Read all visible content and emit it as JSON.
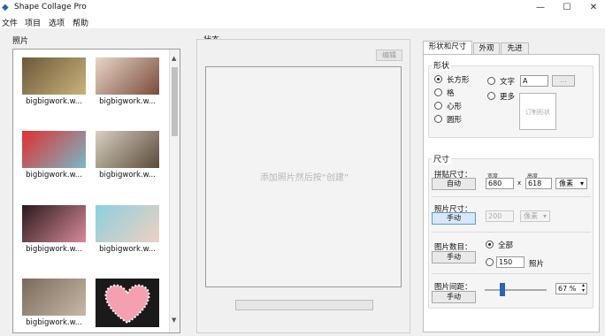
{
  "window": {
    "title": "Shape Collage Pro",
    "minimize": "—",
    "maximize": "☐",
    "close": "✕"
  },
  "menu": [
    "文件",
    "项目",
    "选项",
    "帮助"
  ],
  "photos_panel": {
    "label": "照片",
    "items": [
      {
        "label": "bigbigwork.w...",
        "colors": [
          "#6b5a3a",
          "#c9b27a"
        ]
      },
      {
        "label": "bigbigwork.w...",
        "colors": [
          "#e8d6c8",
          "#7a4b3a"
        ]
      },
      {
        "label": "bigbigwork.w...",
        "colors": [
          "#e03030",
          "#78b8c8"
        ]
      },
      {
        "label": "bigbigwork.w...",
        "colors": [
          "#d8d0c0",
          "#5a4a3a"
        ]
      },
      {
        "label": "bigbigwork.w...",
        "colors": [
          "#2a1a1a",
          "#d88a9a"
        ]
      },
      {
        "label": "bigbigwork.w...",
        "colors": [
          "#8ad0e0",
          "#f0d0c0"
        ]
      },
      {
        "label": "bigbigwork.w...",
        "colors": [
          "#7a6a5a",
          "#c8b8a8"
        ]
      },
      {
        "label": "",
        "colors": [
          "#1a1a1a",
          "#f4a0b0"
        ]
      }
    ]
  },
  "status_panel": {
    "label": "状态",
    "edit_button": "编辑",
    "canvas_hint": "添加照片然后按“创建”"
  },
  "tabs": [
    "形状和尺寸",
    "外观",
    "先进"
  ],
  "shape": {
    "legend": "形状",
    "options": [
      "长方形",
      "格",
      "心形",
      "圆形"
    ],
    "text_option": "文字",
    "text_value": "A",
    "browse": "...",
    "more_option": "更多",
    "custom_shape": "订制形状"
  },
  "size": {
    "legend": "尺寸",
    "collage_size_label": "拼贴尺寸：",
    "auto_button": "自动",
    "width_label": "宽度",
    "height_label": "高度",
    "width_value": "680",
    "times": "x",
    "height_value": "618",
    "unit": "像素",
    "photo_size_label": "照片尺寸：",
    "manual_button": "手动",
    "photo_size_value": "200",
    "photo_unit": "像素",
    "photo_count_label": "图片数目：",
    "count_manual": "手动",
    "all_option": "全部",
    "count_value": "150",
    "count_unit": "照片",
    "spacing_label": "图片间距：",
    "spacing_manual": "手动",
    "spacing_value": "67 %"
  }
}
